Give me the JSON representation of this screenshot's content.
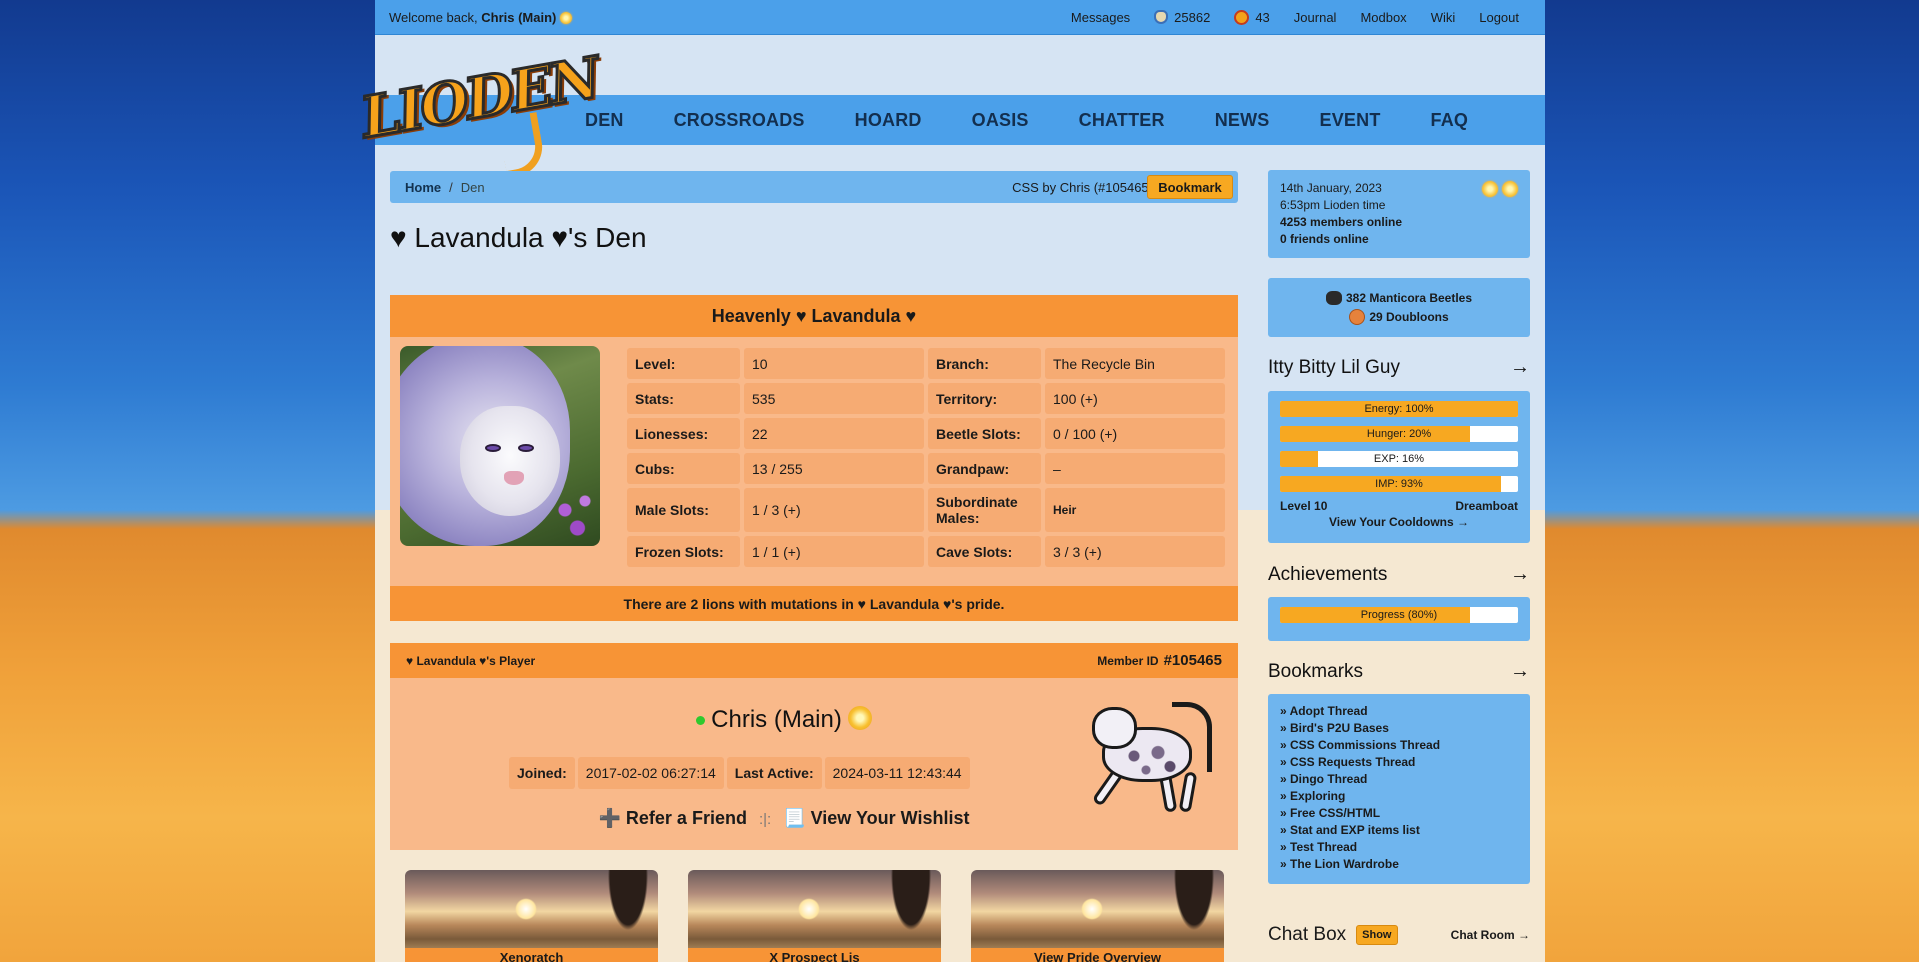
{
  "topbar": {
    "welcome": "Welcome back,",
    "user": "Chris (Main)",
    "messages": "Messages",
    "beetles": "25862",
    "ladybugs": "43",
    "journal": "Journal",
    "modbox": "Modbox",
    "wiki": "Wiki",
    "logout": "Logout"
  },
  "logo": "LIODEN",
  "nav": [
    "DEN",
    "CROSSROADS",
    "HOARD",
    "OASIS",
    "CHATTER",
    "NEWS",
    "EVENT",
    "FAQ"
  ],
  "breadcrumb": {
    "home": "Home",
    "sep": "/",
    "current": "Den",
    "css": "CSS by Chris (#105465)",
    "bookmark": "Bookmark"
  },
  "den_title": "♥ Lavandula ♥'s Den",
  "lion": {
    "name": "Heavenly ♥ Lavandula ♥",
    "stats": [
      {
        "k": "Level:",
        "v": "10",
        "k2": "Branch:",
        "v2": "The Recycle Bin"
      },
      {
        "k": "Stats:",
        "v": "535",
        "k2": "Territory:",
        "v2": "100 (+)"
      },
      {
        "k": "Lionesses:",
        "v": "22",
        "k2": "Beetle Slots:",
        "v2": "0 / 100 (+)"
      },
      {
        "k": "Cubs:",
        "v": "13 / 255",
        "k2": "Grandpaw:",
        "v2": "–"
      },
      {
        "k": "Male Slots:",
        "v": "1 / 3 (+)",
        "k2": "Subordinate Males:",
        "v2": "Heir"
      },
      {
        "k": "Frozen Slots:",
        "v": "1 / 1 (+)",
        "k2": "Cave Slots:",
        "v2": "3 / 3 (+)"
      }
    ],
    "mutations": "There are 2 lions with mutations in ♥ Lavandula ♥'s pride."
  },
  "player": {
    "header": "♥ Lavandula ♥'s Player",
    "member_label": "Member ID",
    "member_id": "#105465",
    "name": "Chris (Main)",
    "joined_label": "Joined:",
    "joined": "2017-02-02 06:27:14",
    "active_label": "Last Active:",
    "active": "2024-03-11 12:43:44",
    "refer": "➕ Refer a Friend",
    "sep": ":|:",
    "wishlist": "📃 View Your Wishlist"
  },
  "cards": [
    "Xenoratch",
    "X Prospect Lis",
    "View Pride Overview"
  ],
  "side": {
    "date": "14th January, 2023",
    "time": "6:53pm Lioden time",
    "members": "4253 members online",
    "friends": "0 friends online",
    "beetles": "382 Manticora Beetles",
    "doubloons": "29 Doubloons",
    "lion_title": "Itty Bitty Lil Guy",
    "arrow": "→",
    "bars": [
      {
        "label": "Energy: 100%",
        "pct": 100
      },
      {
        "label": "Hunger: 20%",
        "pct": 80
      },
      {
        "label": "EXP: 16%",
        "pct": 16
      },
      {
        "label": "IMP: 93%",
        "pct": 93
      }
    ],
    "level": "Level 10",
    "branch": "Dreamboat",
    "cooldowns": "View Your Cooldowns →",
    "ach_title": "Achievements",
    "ach_bar": {
      "label": "Progress (80%)",
      "pct": 80
    },
    "bm_title": "Bookmarks",
    "bookmarks": [
      "» Adopt Thread",
      "» Bird's P2U Bases",
      "» CSS Commissions Thread",
      "» CSS Requests Thread",
      "» Dingo Thread",
      "» Exploring",
      "» Free CSS/HTML",
      "» Stat and EXP items list",
      "» Test Thread",
      "» The Lion Wardrobe"
    ],
    "chat": "Chat Box",
    "show": "Show",
    "room": "Chat Room →"
  }
}
